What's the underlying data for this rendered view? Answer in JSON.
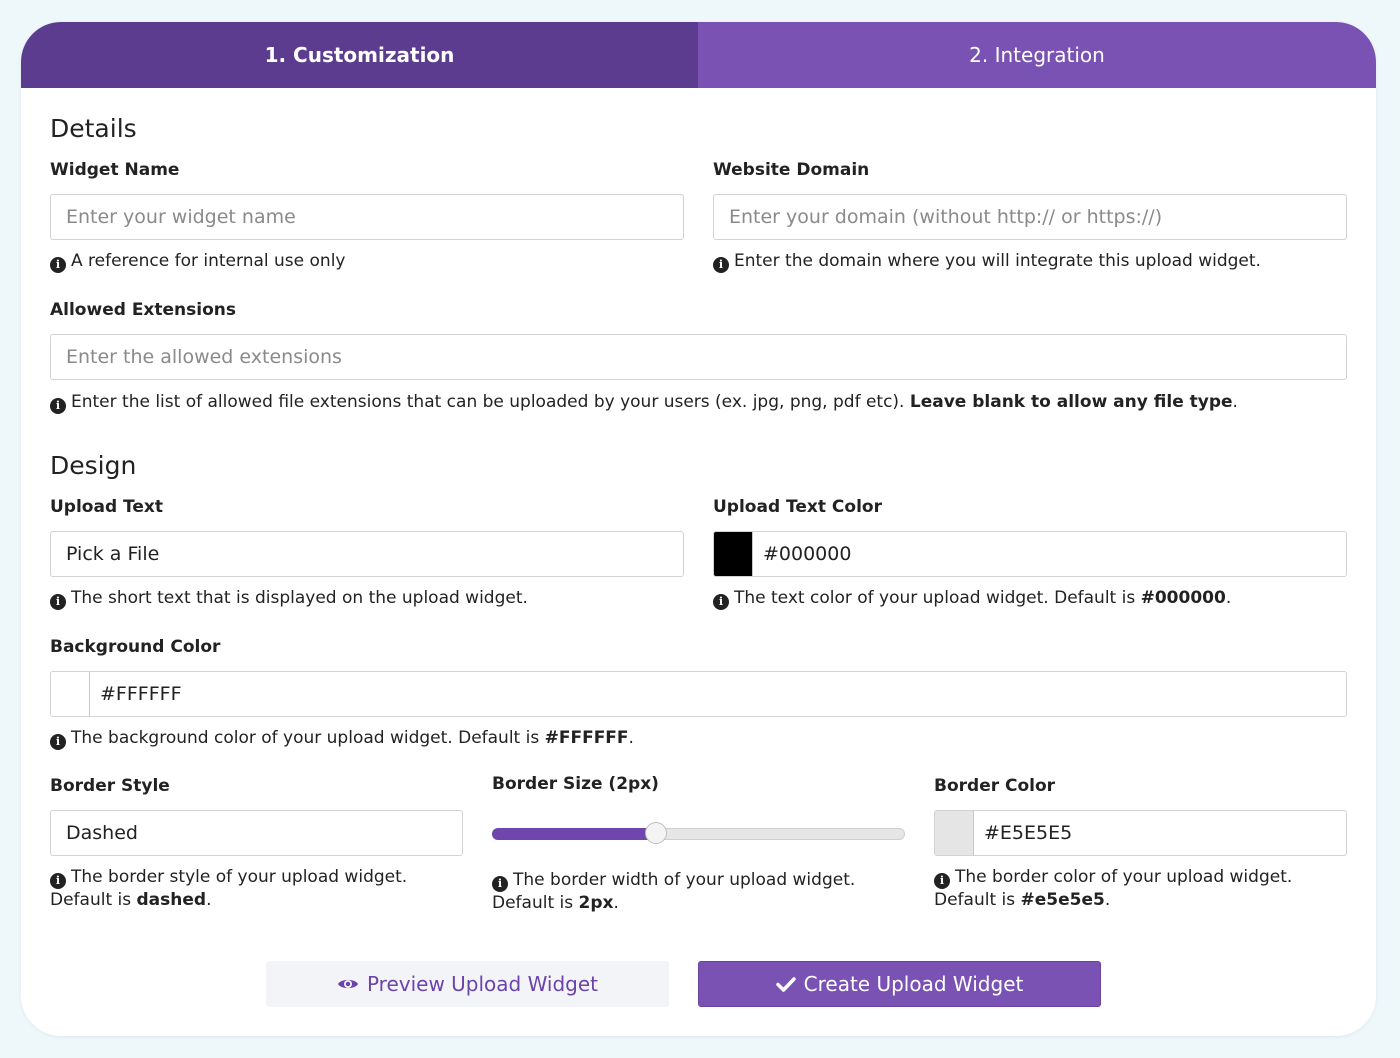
{
  "tabs": [
    {
      "label": "1. Customization",
      "active": true
    },
    {
      "label": "2. Integration",
      "active": false
    }
  ],
  "details": {
    "title": "Details",
    "widget_name": {
      "label": "Widget Name",
      "placeholder": "Enter your widget name",
      "help": "A reference for internal use only"
    },
    "website_domain": {
      "label": "Website Domain",
      "placeholder": "Enter your domain (without http:// or https://)",
      "help": "Enter the domain where you will integrate this upload widget."
    },
    "allowed_extensions": {
      "label": "Allowed Extensions",
      "placeholder": "Enter the allowed extensions",
      "help": "Enter the list of allowed file extensions that can be uploaded by your users (ex. jpg, png, pdf etc).",
      "help_bold": "Leave blank to allow any file type",
      "help_end": "."
    }
  },
  "design": {
    "title": "Design",
    "upload_text": {
      "label": "Upload Text",
      "value": "Pick a File",
      "help": "The short text that is displayed on the upload widget."
    },
    "upload_text_color": {
      "label": "Upload Text Color",
      "value": "#000000",
      "swatch": "#000000",
      "help": "The text color of your upload widget. Default is",
      "help_bold": "#000000",
      "help_end": "."
    },
    "background_color": {
      "label": "Background Color",
      "value": "#FFFFFF",
      "swatch": "#FFFFFF",
      "help": "The background color of your upload widget. Default is",
      "help_bold": "#FFFFFF",
      "help_end": "."
    },
    "border_style": {
      "label": "Border Style",
      "value": "Dashed",
      "help_line1": "The border style of your upload widget.",
      "help_line2": "Default is",
      "help_bold": "dashed",
      "help_end": "."
    },
    "border_size": {
      "label": "Border Size (2px)",
      "value": 2,
      "min": 0,
      "max": 10,
      "help_line1": "The border width of your upload widget.",
      "help_line2": "Default is",
      "help_bold": "2px",
      "help_end": "."
    },
    "border_color": {
      "label": "Border Color",
      "value": "#E5E5E5",
      "swatch": "#E5E5E5",
      "help_line1": "The border color of your upload widget.",
      "help_line2": "Default is",
      "help_bold": "#e5e5e5",
      "help_end": "."
    }
  },
  "buttons": {
    "preview": "Preview Upload Widget",
    "create": "Create Upload Widget"
  },
  "icons": {
    "preview": "eye-icon",
    "create": "check-icon",
    "help": "info-icon"
  },
  "colors": {
    "tab_active": "#5c3c8e",
    "tab_inactive": "#7a52b3",
    "accent": "#7a52b3"
  }
}
